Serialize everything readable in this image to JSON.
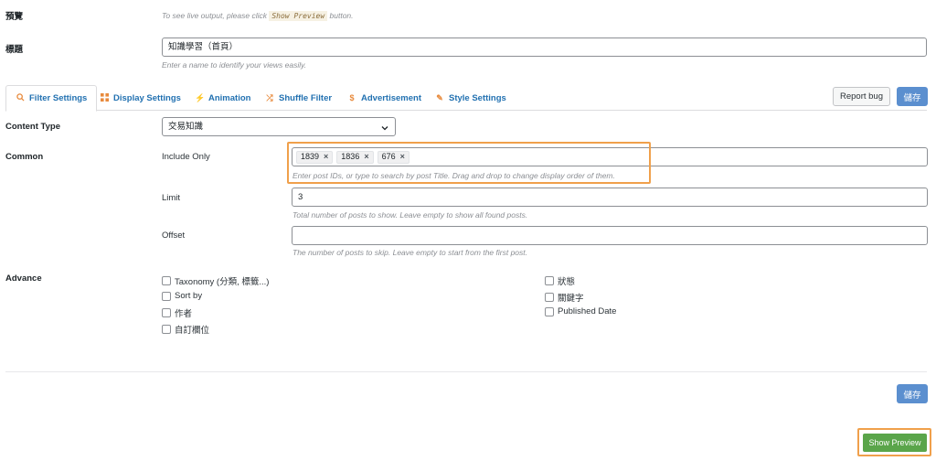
{
  "preview": {
    "label": "預覽",
    "hint_before": "To see live output, please click",
    "hint_code": "Show Preview",
    "hint_after": "button."
  },
  "title_field": {
    "label": "標題",
    "value": "知識學習（首頁）",
    "hint": "Enter a name to identify your views easily."
  },
  "tabs": [
    {
      "label": "Filter Settings",
      "icon": "search-icon"
    },
    {
      "label": "Display Settings",
      "icon": "grid-icon"
    },
    {
      "label": "Animation",
      "icon": "bolt-icon"
    },
    {
      "label": "Shuffle Filter",
      "icon": "shuffle-icon"
    },
    {
      "label": "Advertisement",
      "icon": "dollar-icon"
    },
    {
      "label": "Style Settings",
      "icon": "pencil-icon"
    }
  ],
  "toolbar": {
    "report_bug": "Report bug",
    "save": "儲存"
  },
  "content_type": {
    "label": "Content Type",
    "value": "交易知識"
  },
  "common": {
    "label": "Common",
    "include_only": {
      "label": "Include Only",
      "tags": [
        "1839",
        "1836",
        "676"
      ],
      "remove_symbol": "×",
      "hint": "Enter post IDs, or type to search by post Title. Drag and drop to change display order of them."
    },
    "limit": {
      "label": "Limit",
      "value": "3",
      "hint": "Total number of posts to show. Leave empty to show all found posts."
    },
    "offset": {
      "label": "Offset",
      "value": "",
      "hint": "The number of posts to skip. Leave empty to start from the first post."
    }
  },
  "advance": {
    "label": "Advance",
    "left_options": [
      "Taxonomy (分類, 標籤...)",
      "Sort by",
      "作者",
      "自訂欄位"
    ],
    "right_options": [
      "狀態",
      "關鍵字",
      "Published Date"
    ]
  },
  "footer": {
    "save": "儲存",
    "show_preview": "Show Preview"
  },
  "colors": {
    "accent_blue": "#2271b1",
    "save_button": "#5b8fcf",
    "preview_button": "#5aa54a",
    "highlight_orange": "#f0a04b",
    "tab_icon": "#e88a3c"
  }
}
